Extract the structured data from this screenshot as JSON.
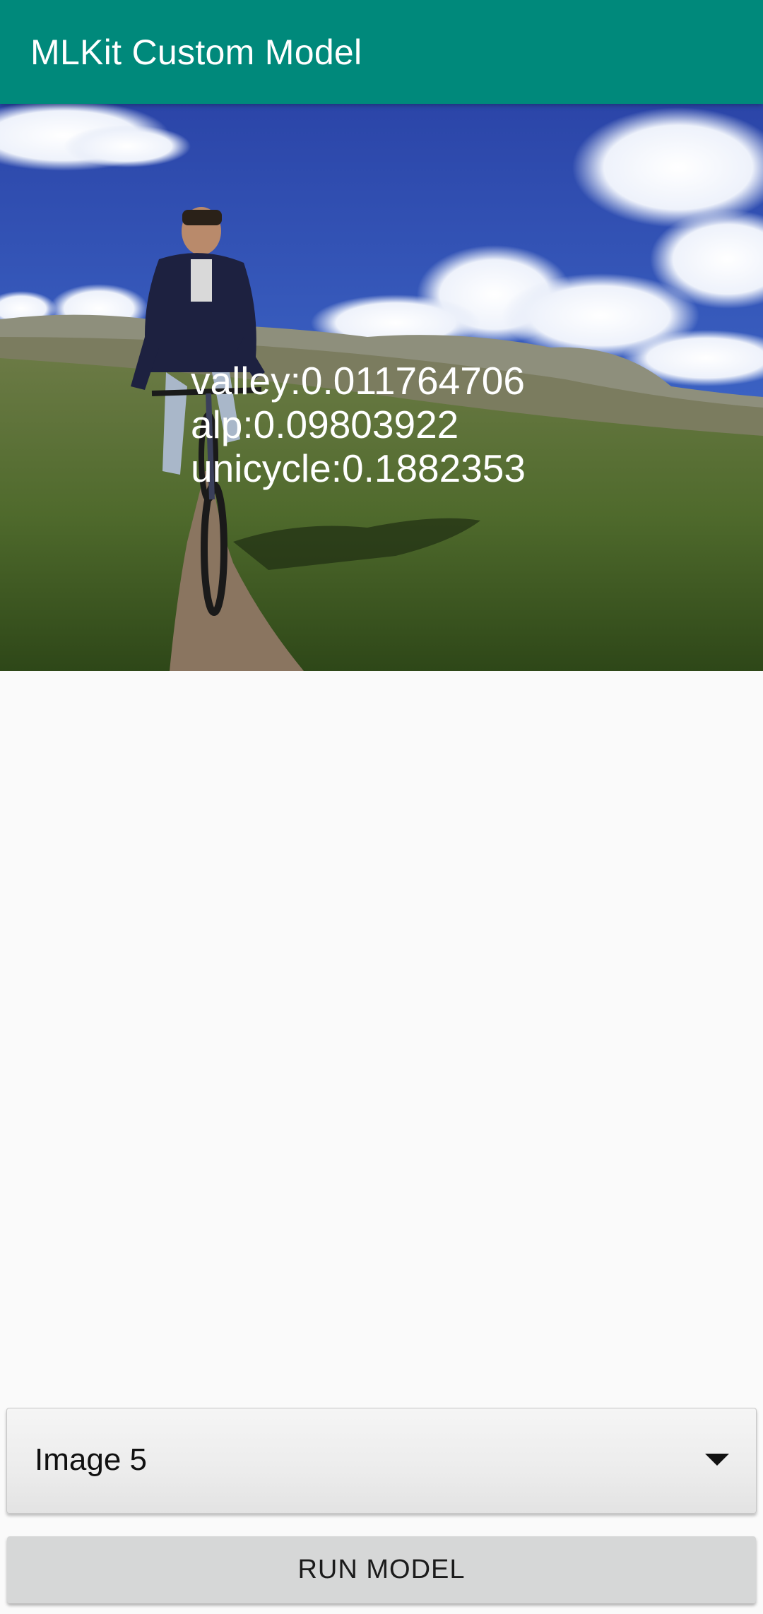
{
  "app_bar": {
    "title": "MLKit Custom Model",
    "color": "#00897b"
  },
  "results": {
    "labels": [
      "valley:0.011764706",
      "alp:0.09803922",
      "unicycle:0.1882353"
    ]
  },
  "spinner": {
    "selected": "Image 5",
    "arrow_icon": "triangle-down-icon"
  },
  "run_button": {
    "label": "RUN MODEL"
  }
}
